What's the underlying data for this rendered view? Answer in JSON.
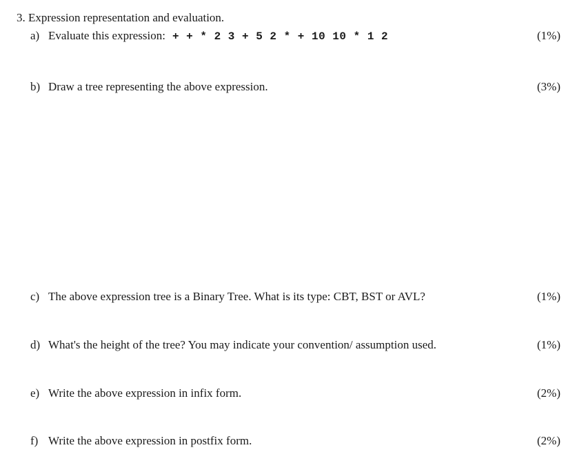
{
  "question": {
    "number": "3.",
    "title": "Expression representation and evaluation."
  },
  "parts": {
    "a": {
      "label": "a)",
      "text": "Evaluate this expression:",
      "expression": "+ + * 2  3 + 5  2 * + 10  10 * 1  2",
      "percent": "(1%)"
    },
    "b": {
      "label": "b)",
      "text": "Draw a tree representing the above expression.",
      "percent": "(3%)"
    },
    "c": {
      "label": "c)",
      "text": "The above expression tree is a Binary Tree.  What is its type: CBT, BST or AVL?",
      "percent": "(1%)"
    },
    "d": {
      "label": "d)",
      "text": "What's the height of the tree?  You may indicate your convention/ assumption used.",
      "percent": "(1%)"
    },
    "e": {
      "label": "e)",
      "text": "Write the above expression in infix form.",
      "percent": "(2%)"
    },
    "f": {
      "label": "f)",
      "text": "Write the above expression in postfix form.",
      "percent": "(2%)"
    }
  }
}
